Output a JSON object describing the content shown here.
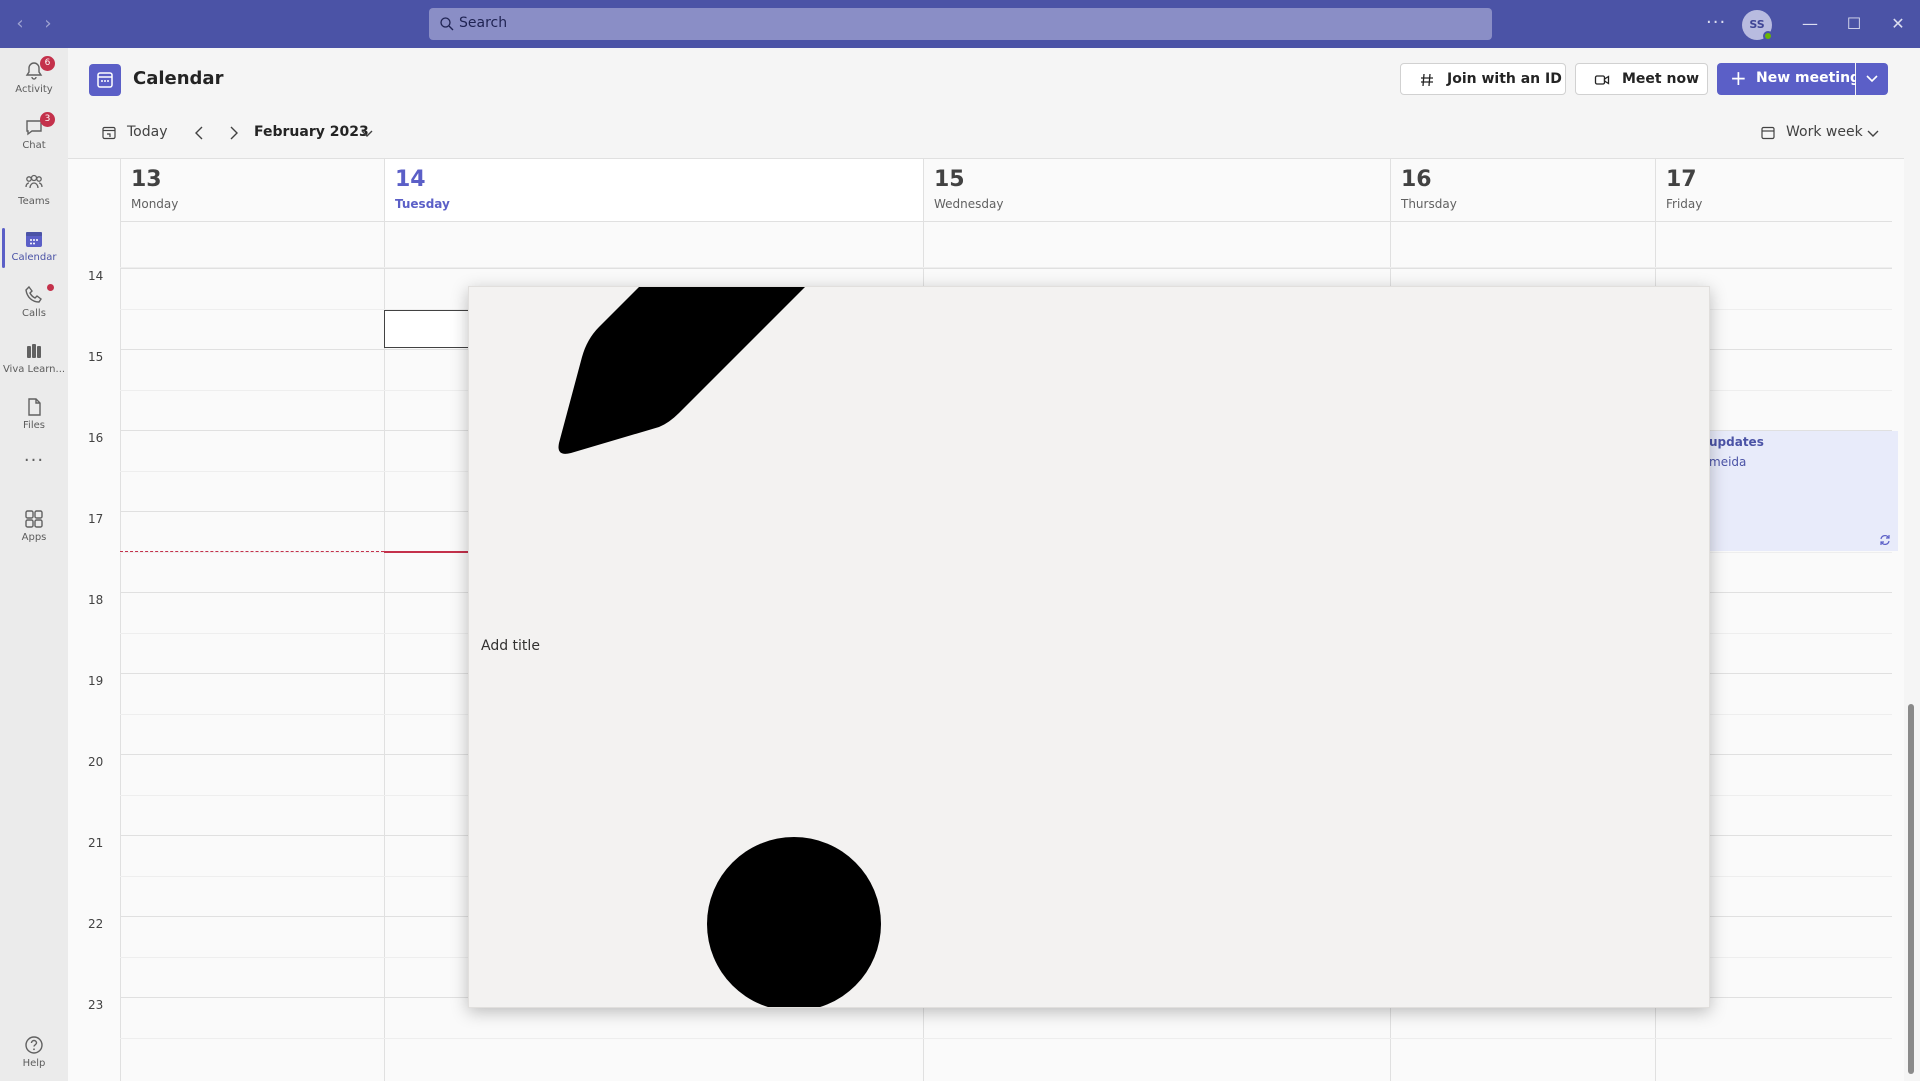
{
  "titlebar": {
    "search_placeholder": "Search",
    "avatar_initials": "SS"
  },
  "rail": {
    "items": [
      {
        "label": "Activity",
        "badge": "6"
      },
      {
        "label": "Chat",
        "badge": "3"
      },
      {
        "label": "Teams"
      },
      {
        "label": "Calendar"
      },
      {
        "label": "Calls"
      },
      {
        "label": "Viva Learn..."
      },
      {
        "label": "Files"
      },
      {
        "label": "Apps"
      }
    ],
    "help_label": "Help"
  },
  "header": {
    "title": "Calendar",
    "join_label": "Join with an ID",
    "meet_label": "Meet now",
    "new_meeting_label": "New meeting"
  },
  "toolbar": {
    "today_label": "Today",
    "month_label": "February 2023",
    "view_label": "Work week"
  },
  "days": [
    {
      "num": "13",
      "name": "Monday"
    },
    {
      "num": "14",
      "name": "Tuesday"
    },
    {
      "num": "15",
      "name": "Wednesday"
    },
    {
      "num": "16",
      "name": "Thursday"
    },
    {
      "num": "17",
      "name": "Friday"
    }
  ],
  "hours": [
    "14",
    "15",
    "16",
    "17",
    "18",
    "19",
    "20",
    "21",
    "22",
    "23"
  ],
  "event": {
    "title": "updates",
    "organizer": "meida"
  },
  "overlay": {
    "add_title": "Add title"
  },
  "colors": {
    "brand": "#5b5fc7",
    "titlebar": "#4b53a6",
    "badge": "#c4314b",
    "now_line": "#c4314b"
  }
}
